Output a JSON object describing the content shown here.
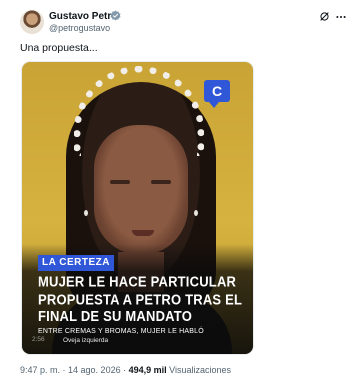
{
  "author": {
    "name": "Gustavo Petro",
    "handle": "@petrogustavo"
  },
  "tweet": {
    "text": "Una propuesta..."
  },
  "media": {
    "channel_badge": "C",
    "brand_tag": "LA CERTEZA",
    "headline": "MUJER LE HACE PARTICULAR PROPUESTA A PETRO TRAS EL FINAL DE SU MANDATO",
    "subline": "ENTRE CREMAS Y BROMAS, MUJER LE HABLÓ",
    "ticker": "2:56",
    "credit": "Oveja izquierda"
  },
  "meta": {
    "time": "9:47 p. m.",
    "sep1": " · ",
    "date": "14 ago. 2026",
    "sep2": " · ",
    "views_count": "494,9 mil",
    "views_label": " Visualizaciones"
  },
  "colors": {
    "brand_blue": "#2f57d8",
    "verified": "#829aab",
    "text_primary": "#0f1419",
    "text_secondary": "#536471"
  }
}
